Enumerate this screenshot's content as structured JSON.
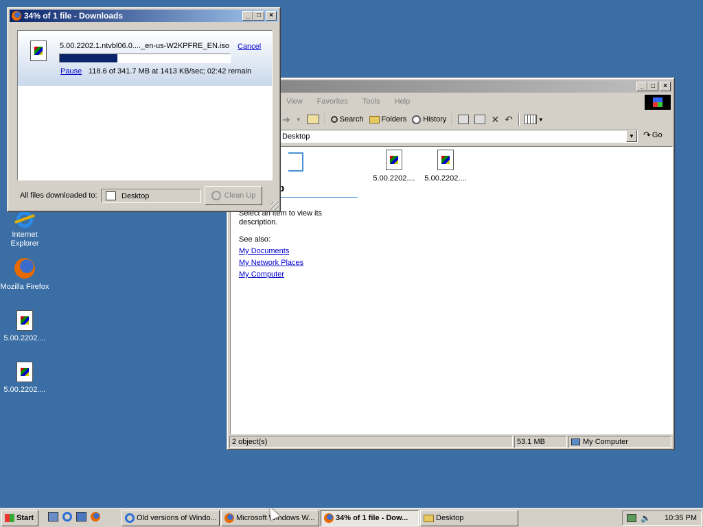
{
  "desktop": {
    "icons": [
      {
        "label": "Internet Explorer",
        "icon": "ie-icon"
      },
      {
        "label": "Mozilla Firefox",
        "icon": "firefox-icon"
      },
      {
        "label": "5.00.2202....",
        "icon": "iso-file-icon"
      },
      {
        "label": "5.00.2202....",
        "icon": "iso-file-icon"
      }
    ]
  },
  "downloads": {
    "title": "34% of 1 file - Downloads",
    "filename": "5.00.2202.1.ntvbl06.0...._en-us-W2KPFRE_EN.iso",
    "cancel": "Cancel",
    "pause": "Pause",
    "status": "118.6 of 341.7 MB at 1413 KB/sec; 02:42 remain",
    "progress": 0.34,
    "footer_label": "All files downloaded to:",
    "folder": "Desktop",
    "cleanup": "Clean Up"
  },
  "explorer": {
    "menu": [
      "View",
      "Favorites",
      "Tools",
      "Help"
    ],
    "toolbar": {
      "search": "Search",
      "folders": "Folders",
      "history": "History"
    },
    "address": "Desktop",
    "go": "Go",
    "files": [
      {
        "label": "5.00.2202...."
      },
      {
        "label": "5.00.2202...."
      }
    ],
    "panel": {
      "heading": "p",
      "desc": "Select an item to view its description.",
      "see_also": "See also:",
      "links": [
        "My Documents",
        "My Network Places",
        "My Computer"
      ]
    },
    "status": {
      "objects": "2 object(s)",
      "size": "53.1 MB",
      "location": "My Computer"
    }
  },
  "taskbar": {
    "start": "Start",
    "tasks": [
      {
        "label": "Old versions of Windo...",
        "icon": "ie-icon"
      },
      {
        "label": "Microsoft Windows W...",
        "icon": "firefox-icon"
      },
      {
        "label": "34% of 1 file - Dow...",
        "icon": "firefox-icon",
        "active": true
      },
      {
        "label": "Desktop",
        "icon": "folder-icon"
      }
    ],
    "clock": "10:35 PM"
  }
}
